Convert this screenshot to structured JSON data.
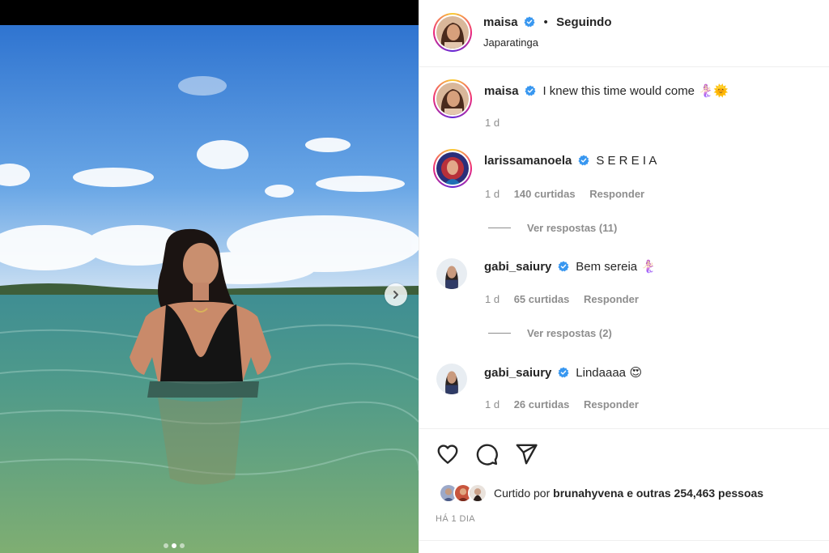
{
  "post": {
    "author": "maisa",
    "follow_status": "Seguindo",
    "location": "Japaratinga",
    "caption": "I knew this time would come",
    "caption_emoji": "🧜🏻‍♀️🌞",
    "caption_time": "1 d",
    "carousel": {
      "slide_count": 3,
      "active_slide": 2
    }
  },
  "comments": [
    {
      "user": "larissamanoela",
      "text": "S E R E I A",
      "time": "1 d",
      "likes": "140 curtidas",
      "reply_label": "Responder",
      "view_replies": "Ver respostas (11)"
    },
    {
      "user": "gabi_saiury",
      "text": "Bem sereia",
      "emoji": "🧜🏻‍♀️",
      "time": "1 d",
      "likes": "65 curtidas",
      "reply_label": "Responder",
      "view_replies": "Ver respostas (2)"
    },
    {
      "user": "gabi_saiury",
      "text": "Lindaaaa",
      "emoji": "😍",
      "time": "1 d",
      "likes": "26 curtidas",
      "reply_label": "Responder"
    }
  ],
  "likes": {
    "prefix": "Curtido por",
    "user": "bruna​hyvena",
    "suffix": "e outras 254,463 pessoas"
  },
  "posted_ago": "HÁ 1 DIA",
  "icons": [
    "heart-icon",
    "comment-icon",
    "share-icon",
    "verified-badge-icon",
    "chevron-right-icon"
  ],
  "colors": {
    "verified": "#3897f0",
    "secondary_text": "#8e8e8e",
    "divider": "#efefef"
  }
}
